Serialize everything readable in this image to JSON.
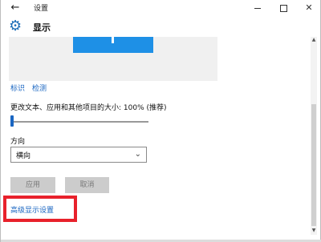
{
  "window": {
    "title": "设置",
    "back_icon": "arrow-left-icon",
    "minimize_icon": "minimize-icon",
    "maximize_icon": "maximize-icon",
    "close_icon": "close-icon",
    "close_glyph": "✕",
    "back_glyph": "←"
  },
  "header": {
    "icon": "gear-icon",
    "icon_glyph": "⚙",
    "title": "显示"
  },
  "display": {
    "identify_label": "标识",
    "detect_label": "检测",
    "scale_label": "更改文本、应用和其他项目的大小: 100% (推荐)",
    "scale_percent": 100,
    "orientation_label": "方向",
    "orientation_value": "横向",
    "chevron_glyph": "⌄",
    "apply_label": "应用",
    "cancel_label": "取消",
    "advanced_label": "高级显示设置"
  },
  "colors": {
    "accent": "#1e90e6",
    "link": "#1a66c2",
    "highlight_border": "#e8212b"
  },
  "scrollbar": {
    "up_glyph": "▲",
    "down_glyph": "▼"
  }
}
